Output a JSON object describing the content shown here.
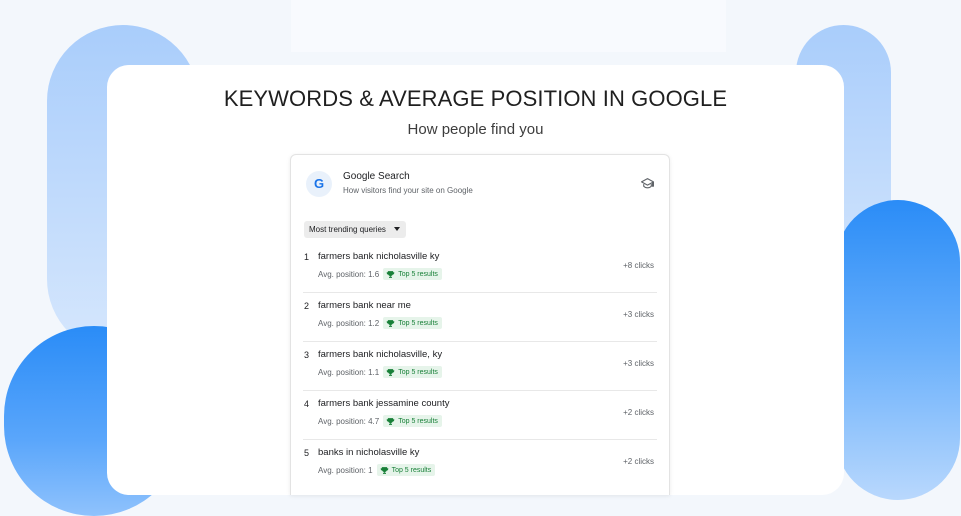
{
  "page": {
    "title": "KEYWORDS & AVERAGE POSITION IN GOOGLE",
    "subtitle": "How people find you"
  },
  "panel": {
    "badge_letter": "G",
    "title": "Google Search",
    "subtitle": "How visitors find your site on Google",
    "header_icon": "graduation-cap-icon",
    "dropdown_label": "Most trending queries"
  },
  "queries": [
    {
      "rank": "1",
      "query": "farmers bank nicholasville ky",
      "position_text": "Avg. position: 1.6",
      "badge": "Top 5 results",
      "clicks": "+8 clicks"
    },
    {
      "rank": "2",
      "query": "farmers bank near me",
      "position_text": "Avg. position: 1.2",
      "badge": "Top 5 results",
      "clicks": "+3 clicks"
    },
    {
      "rank": "3",
      "query": "farmers bank nicholasville, ky",
      "position_text": "Avg. position: 1.1",
      "badge": "Top 5 results",
      "clicks": "+3 clicks"
    },
    {
      "rank": "4",
      "query": "farmers bank jessamine county",
      "position_text": "Avg. position: 4.7",
      "badge": "Top 5 results",
      "clicks": "+2 clicks"
    },
    {
      "rank": "5",
      "query": "banks in nicholasville ky",
      "position_text": "Avg. position: 1",
      "badge": "Top 5 results",
      "clicks": "+2 clicks"
    }
  ],
  "colors": {
    "accent_blue": "#2a8cf7",
    "light_blue": "#a9cdfb",
    "badge_green": "#188038",
    "badge_bg": "#e6f4ea"
  }
}
